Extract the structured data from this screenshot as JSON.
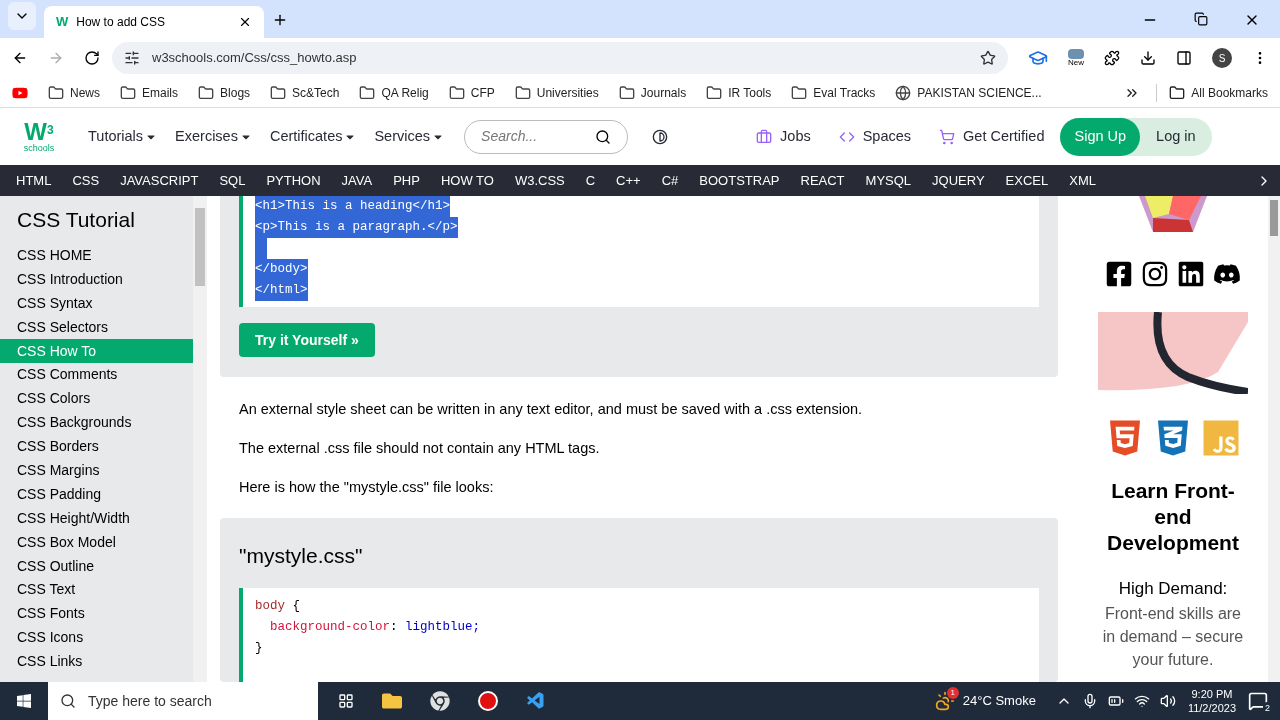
{
  "browser": {
    "favicon": "W",
    "tab_title": "How to add CSS",
    "url": "w3schools.com/Css/css_howto.asp",
    "new_badge": "New",
    "profile": "S",
    "bookmarks": [
      {
        "kind": "youtube"
      },
      {
        "kind": "folder",
        "label": "News"
      },
      {
        "kind": "folder",
        "label": "Emails"
      },
      {
        "kind": "folder",
        "label": "Blogs"
      },
      {
        "kind": "folder",
        "label": "Sc&Tech"
      },
      {
        "kind": "folder",
        "label": "QA Relig"
      },
      {
        "kind": "folder",
        "label": "CFP"
      },
      {
        "kind": "folder",
        "label": "Universities"
      },
      {
        "kind": "folder",
        "label": "Journals"
      },
      {
        "kind": "folder",
        "label": "IR Tools"
      },
      {
        "kind": "folder",
        "label": "Eval Tracks"
      },
      {
        "kind": "globe",
        "label": "PAKISTAN SCIENCE..."
      }
    ],
    "all_bookmarks": "All Bookmarks"
  },
  "header": {
    "logo": {
      "mark": "W",
      "sup": "3",
      "word": "schools"
    },
    "menus": [
      "Tutorials",
      "Exercises",
      "Certificates",
      "Services"
    ],
    "search": {
      "placeholder": "Search..."
    },
    "links": [
      {
        "kind": "jobs",
        "label": "Jobs"
      },
      {
        "kind": "spaces",
        "label": "Spaces"
      },
      {
        "kind": "cart",
        "label": "Get Certified"
      }
    ],
    "sign_up": "Sign Up",
    "log_in": "Log in"
  },
  "topnav": [
    "HTML",
    "CSS",
    "JAVASCRIPT",
    "SQL",
    "PYTHON",
    "JAVA",
    "PHP",
    "HOW TO",
    "W3.CSS",
    "C",
    "C++",
    "C#",
    "BOOTSTRAP",
    "REACT",
    "MYSQL",
    "JQUERY",
    "EXCEL",
    "XML"
  ],
  "sidebar": {
    "title": "CSS Tutorial",
    "items": [
      {
        "label": "CSS HOME",
        "selected": false
      },
      {
        "label": "CSS Introduction",
        "selected": false
      },
      {
        "label": "CSS Syntax",
        "selected": false
      },
      {
        "label": "CSS Selectors",
        "selected": false
      },
      {
        "label": "CSS How To",
        "selected": true
      },
      {
        "label": "CSS Comments",
        "selected": false
      },
      {
        "label": "CSS Colors",
        "selected": false
      },
      {
        "label": "CSS Backgrounds",
        "selected": false
      },
      {
        "label": "CSS Borders",
        "selected": false
      },
      {
        "label": "CSS Margins",
        "selected": false
      },
      {
        "label": "CSS Padding",
        "selected": false
      },
      {
        "label": "CSS Height/Width",
        "selected": false
      },
      {
        "label": "CSS Box Model",
        "selected": false
      },
      {
        "label": "CSS Outline",
        "selected": false
      },
      {
        "label": "CSS Text",
        "selected": false
      },
      {
        "label": "CSS Fonts",
        "selected": false
      },
      {
        "label": "CSS Icons",
        "selected": false
      },
      {
        "label": "CSS Links",
        "selected": false
      }
    ]
  },
  "example1": {
    "lines": [
      {
        "kind": "code",
        "text": "<h1>This is a heading</h1>",
        "selected": true
      },
      {
        "kind": "code",
        "text": "<p>This is a paragraph.</p>",
        "selected": true
      },
      {
        "kind": "blank",
        "selected": true
      },
      {
        "kind": "code",
        "text": "</body>",
        "selected": true
      },
      {
        "kind": "code",
        "text": "</html>",
        "selected": true
      }
    ],
    "button": "Try it Yourself »"
  },
  "paragraphs": [
    "An external style sheet can be written in any text editor, and must be saved with a .css extension.",
    "The external .css file should not contain any HTML tags.",
    "Here is how the \"mystyle.css\" file looks:"
  ],
  "example2": {
    "title": "\"mystyle.css\"",
    "lines": [
      {
        "indent": false,
        "tokens": [
          {
            "kind": "selector",
            "text": "body"
          },
          {
            "kind": "brace",
            "text": "{"
          }
        ]
      },
      {
        "indent": true,
        "tokens": [
          {
            "kind": "property",
            "text": "background-color"
          },
          {
            "kind": "punct",
            "text": ":"
          },
          {
            "kind": "value",
            "text": "lightblue;"
          }
        ]
      },
      {
        "indent": false,
        "tokens": [
          {
            "kind": "brace",
            "text": "}"
          }
        ]
      }
    ]
  },
  "ad": {
    "title": "Learn Front-end Development",
    "subtitle": "High Demand:",
    "body": "Front-end skills are in demand – secure your future."
  },
  "taskbar": {
    "search_placeholder": "Type here to search",
    "weather_badge": "1",
    "weather": "24°C  Smoke",
    "time": "9:20 PM",
    "date": "11/2/2023",
    "notifications": "2"
  }
}
